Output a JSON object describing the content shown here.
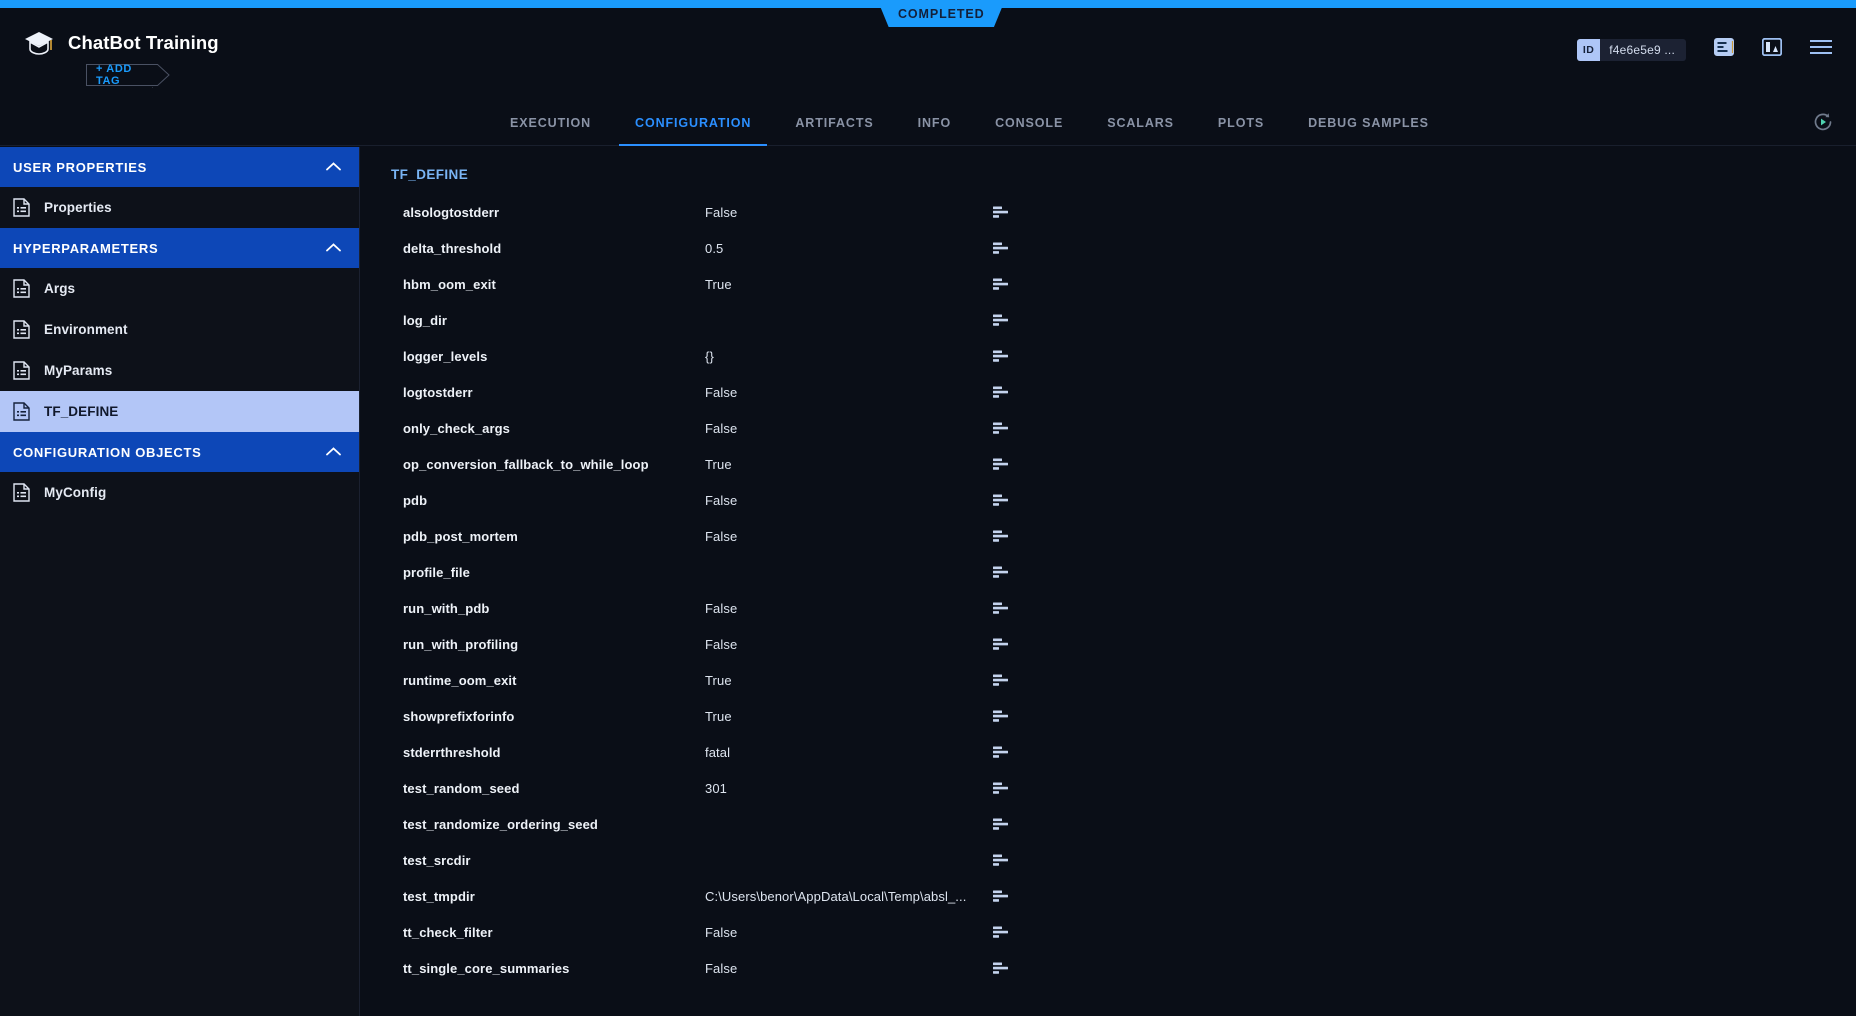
{
  "status": {
    "label": "COMPLETED",
    "color": "#1a9bfc"
  },
  "header": {
    "title": "ChatBot Training",
    "logo_icon": "graduation-cap-icon",
    "add_tag_label": "+ ADD TAG",
    "id_chip": {
      "label": "ID",
      "value": "f4e6e5e9 ..."
    },
    "icons": [
      "log-panel-icon",
      "split-panel-icon",
      "hamburger-menu-icon"
    ]
  },
  "tabs": [
    {
      "label": "EXECUTION",
      "active": false
    },
    {
      "label": "CONFIGURATION",
      "active": true
    },
    {
      "label": "ARTIFACTS",
      "active": false
    },
    {
      "label": "INFO",
      "active": false
    },
    {
      "label": "CONSOLE",
      "active": false
    },
    {
      "label": "SCALARS",
      "active": false
    },
    {
      "label": "PLOTS",
      "active": false
    },
    {
      "label": "DEBUG SAMPLES",
      "active": false
    }
  ],
  "tabbar_action": {
    "icon": "replay-run-icon"
  },
  "sidebar": {
    "sections": [
      {
        "label": "USER PROPERTIES",
        "collapse_icon": "chevron-up-icon",
        "items": [
          {
            "label": "Properties",
            "selected": false
          }
        ]
      },
      {
        "label": "HYPERPARAMETERS",
        "collapse_icon": "chevron-up-icon",
        "items": [
          {
            "label": "Args",
            "selected": false
          },
          {
            "label": "Environment",
            "selected": false
          },
          {
            "label": "MyParams",
            "selected": false
          },
          {
            "label": "TF_DEFINE",
            "selected": true
          }
        ]
      },
      {
        "label": "CONFIGURATION OBJECTS",
        "collapse_icon": "chevron-up-icon",
        "items": [
          {
            "label": "MyConfig",
            "selected": false
          }
        ]
      }
    ]
  },
  "main": {
    "section_title": "TF_DEFINE",
    "row_icon": "bars-chart-icon",
    "rows": [
      {
        "key": "alsologtostderr",
        "value": "False"
      },
      {
        "key": "delta_threshold",
        "value": "0.5"
      },
      {
        "key": "hbm_oom_exit",
        "value": "True"
      },
      {
        "key": "log_dir",
        "value": ""
      },
      {
        "key": "logger_levels",
        "value": "{}"
      },
      {
        "key": "logtostderr",
        "value": "False"
      },
      {
        "key": "only_check_args",
        "value": "False"
      },
      {
        "key": "op_conversion_fallback_to_while_loop",
        "value": "True"
      },
      {
        "key": "pdb",
        "value": "False"
      },
      {
        "key": "pdb_post_mortem",
        "value": "False"
      },
      {
        "key": "profile_file",
        "value": ""
      },
      {
        "key": "run_with_pdb",
        "value": "False"
      },
      {
        "key": "run_with_profiling",
        "value": "False"
      },
      {
        "key": "runtime_oom_exit",
        "value": "True"
      },
      {
        "key": "showprefixforinfo",
        "value": "True"
      },
      {
        "key": "stderrthreshold",
        "value": "fatal"
      },
      {
        "key": "test_random_seed",
        "value": "301"
      },
      {
        "key": "test_randomize_ordering_seed",
        "value": ""
      },
      {
        "key": "test_srcdir",
        "value": ""
      },
      {
        "key": "test_tmpdir",
        "value": "C:\\Users\\benor\\AppData\\Local\\Temp\\absl_..."
      },
      {
        "key": "tt_check_filter",
        "value": "False"
      },
      {
        "key": "tt_single_core_summaries",
        "value": "False"
      }
    ]
  }
}
